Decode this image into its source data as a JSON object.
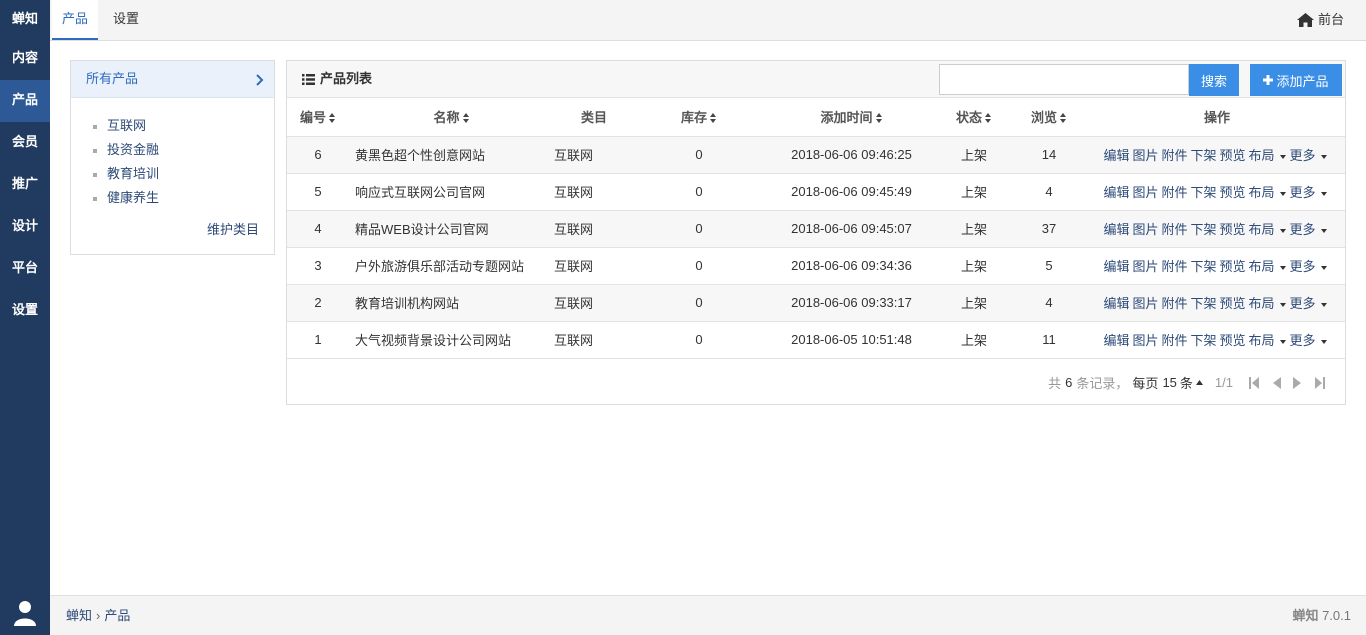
{
  "nav": {
    "brand": "蝉知",
    "items": [
      "内容",
      "产品",
      "会员",
      "推广",
      "设计",
      "平台",
      "设置"
    ],
    "active_index": 1
  },
  "topbar": {
    "tabs": [
      "产品",
      "设置"
    ],
    "active_tab": "产品",
    "frontdesk": "前台"
  },
  "category_panel": {
    "header": "所有产品",
    "items": [
      "互联网",
      "投资金融",
      "教育培训",
      "健康养生"
    ],
    "maintain_link": "维护类目"
  },
  "product_panel": {
    "title": "产品列表",
    "search_placeholder": "",
    "search_label": "搜索",
    "add_label": "添加产品",
    "columns": [
      "编号",
      "名称",
      "类目",
      "库存",
      "添加时间",
      "状态",
      "浏览",
      "操作"
    ],
    "rows": [
      {
        "id": "6",
        "name": "黄黑色超个性创意网站",
        "category": "互联网",
        "stock": "0",
        "added": "2018-06-06 09:46:25",
        "status": "上架",
        "views": "14"
      },
      {
        "id": "5",
        "name": "响应式互联网公司官网",
        "category": "互联网",
        "stock": "0",
        "added": "2018-06-06 09:45:49",
        "status": "上架",
        "views": "4"
      },
      {
        "id": "4",
        "name": "精品WEB设计公司官网",
        "category": "互联网",
        "stock": "0",
        "added": "2018-06-06 09:45:07",
        "status": "上架",
        "views": "37"
      },
      {
        "id": "3",
        "name": "户外旅游俱乐部活动专题网站",
        "category": "互联网",
        "stock": "0",
        "added": "2018-06-06 09:34:36",
        "status": "上架",
        "views": "5"
      },
      {
        "id": "2",
        "name": "教育培训机构网站",
        "category": "互联网",
        "stock": "0",
        "added": "2018-06-06 09:33:17",
        "status": "上架",
        "views": "4"
      },
      {
        "id": "1",
        "name": "大气视频背景设计公司网站",
        "category": "互联网",
        "stock": "0",
        "added": "2018-06-05 10:51:48",
        "status": "上架",
        "views": "11"
      }
    ],
    "actions": [
      "编辑",
      "图片",
      "附件",
      "下架",
      "预览",
      "布局",
      "更多"
    ]
  },
  "pager": {
    "total_prefix": "共",
    "total": "6",
    "total_suffix": "条记录，",
    "per_page_prefix": "每页",
    "per_page": "15",
    "per_page_suffix": "条",
    "page": "1/1"
  },
  "footer": {
    "breadcrumb": [
      "蝉知",
      "产品"
    ],
    "version": "7.0.1"
  },
  "colors": {
    "nav_bg": "#213a5f",
    "nav_active": "#2d5a96",
    "primary_button": "#3a8ee6",
    "link": "#2d4a78"
  }
}
